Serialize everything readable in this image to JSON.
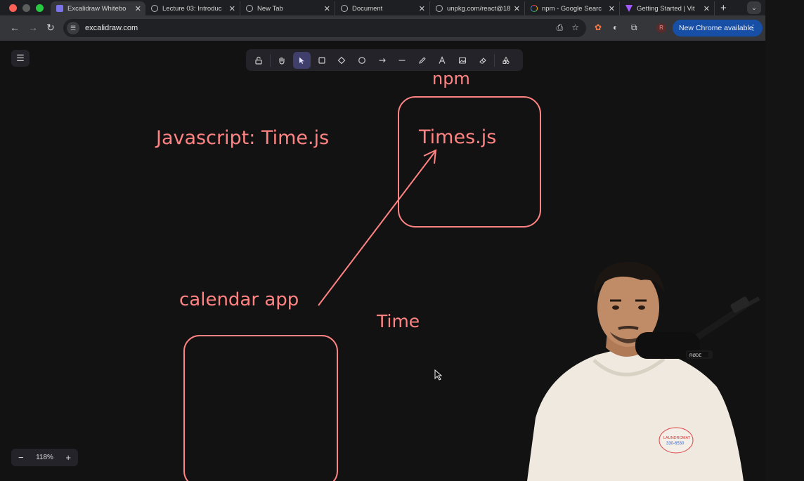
{
  "browser": {
    "tabs": [
      {
        "title": "Excalidraw Whitebo",
        "icon": "excalidraw-icon",
        "active": true
      },
      {
        "title": "Lecture 03: Introduc",
        "icon": "globe-icon"
      },
      {
        "title": "New Tab",
        "icon": "globe-icon"
      },
      {
        "title": "Document",
        "icon": "globe-icon"
      },
      {
        "title": "unpkg.com/react@18",
        "icon": "globe-icon"
      },
      {
        "title": "npm - Google Searc",
        "icon": "google-icon"
      },
      {
        "title": "Getting Started | Vit",
        "icon": "vite-icon"
      }
    ],
    "new_tab": "+",
    "url": "excalidraw.com",
    "profile_initial": "R",
    "update_label": "New Chrome available"
  },
  "excalidraw": {
    "selected_tool": "selection",
    "tools": [
      "lock",
      "hand",
      "selection",
      "rectangle",
      "diamond",
      "ellipse",
      "arrow",
      "line",
      "draw",
      "text",
      "image",
      "eraser",
      "more-tools"
    ],
    "zoom": {
      "value": "118%",
      "minus": "−",
      "plus": "+"
    }
  },
  "canvas_text": {
    "npm": "npm",
    "javascript": "Javascript: Time.js",
    "times": "Times.js",
    "calendar": "calendar app",
    "time": "Time"
  },
  "colors": {
    "stroke": "#ff8383",
    "canvas_bg": "#121212",
    "tool_selected": "#403e6a"
  },
  "webcam": {
    "hoodie_text": "LAUNDROMAT"
  }
}
